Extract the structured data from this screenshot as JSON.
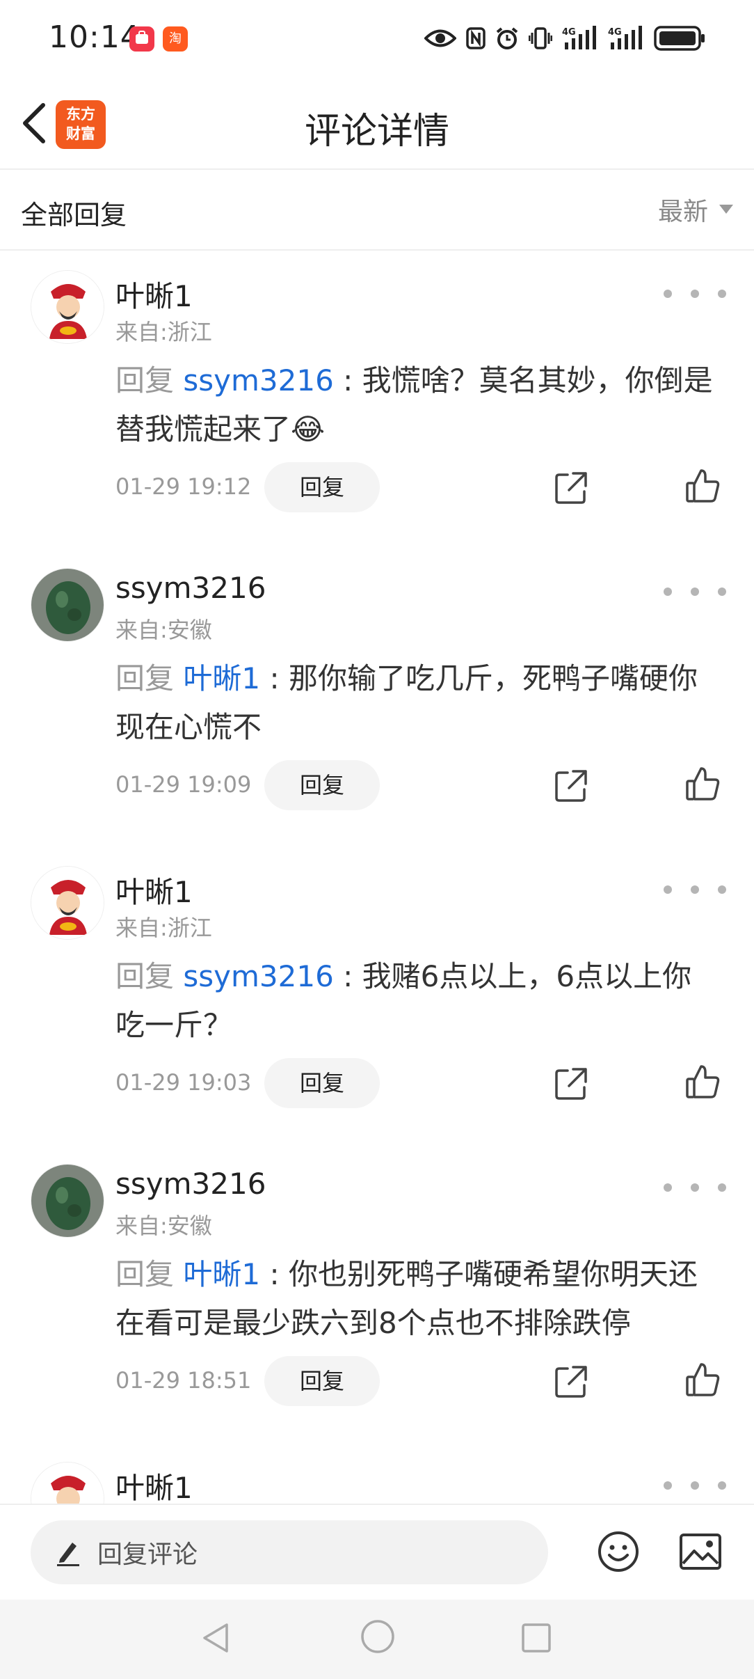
{
  "status_bar": {
    "time": "10:14",
    "app_badges": [
      "pinduoduo-icon",
      "taobao-icon"
    ],
    "taobao_glyph": "淘",
    "indicators": [
      "eye-icon",
      "nfc-icon",
      "alarm-icon",
      "vibrate-icon",
      "signal-4g-icon",
      "signal-4g-icon",
      "battery-icon"
    ]
  },
  "header": {
    "title": "评论详情",
    "logo_line1": "东方",
    "logo_line2": "财富"
  },
  "filter": {
    "label": "全部回复",
    "sort_label": "最新"
  },
  "comments": [
    {
      "user": "叶晰1",
      "location": "来自:浙江",
      "reply_prefix": "回复",
      "mention": "ssym3216",
      "text": " : 我慌啥？莫名其妙，你倒是替我慌起来了",
      "emoji": "😂",
      "time": "01-29 19:12",
      "reply_label": "回复"
    },
    {
      "user": "ssym3216",
      "location": "来自:安徽",
      "reply_prefix": "回复",
      "mention": "叶晰1",
      "text": " : 那你输了吃几斤，死鸭子嘴硬你现在心慌不",
      "emoji": "",
      "time": "01-29 19:09",
      "reply_label": "回复"
    },
    {
      "user": "叶晰1",
      "location": "来自:浙江",
      "reply_prefix": "回复",
      "mention": "ssym3216",
      "text": " : 我赌6点以上，6点以上你吃一斤？",
      "emoji": "",
      "time": "01-29 19:03",
      "reply_label": "回复"
    },
    {
      "user": "ssym3216",
      "location": "来自:安徽",
      "reply_prefix": "回复",
      "mention": "叶晰1",
      "text": " : 你也别死鸭子嘴硬希望你明天还在看可是最少跌六到8个点也不排除跌停",
      "emoji": "",
      "time": "01-29 18:51",
      "reply_label": "回复"
    },
    {
      "user": "叶晰1",
      "location": "",
      "reply_prefix": "",
      "mention": "",
      "text": "",
      "emoji": "",
      "time": "",
      "reply_label": ""
    }
  ],
  "composer": {
    "placeholder": "回复评论"
  },
  "colors": {
    "mention": "#1e6bd6",
    "brand": "#f25a1f",
    "muted": "#999999"
  }
}
